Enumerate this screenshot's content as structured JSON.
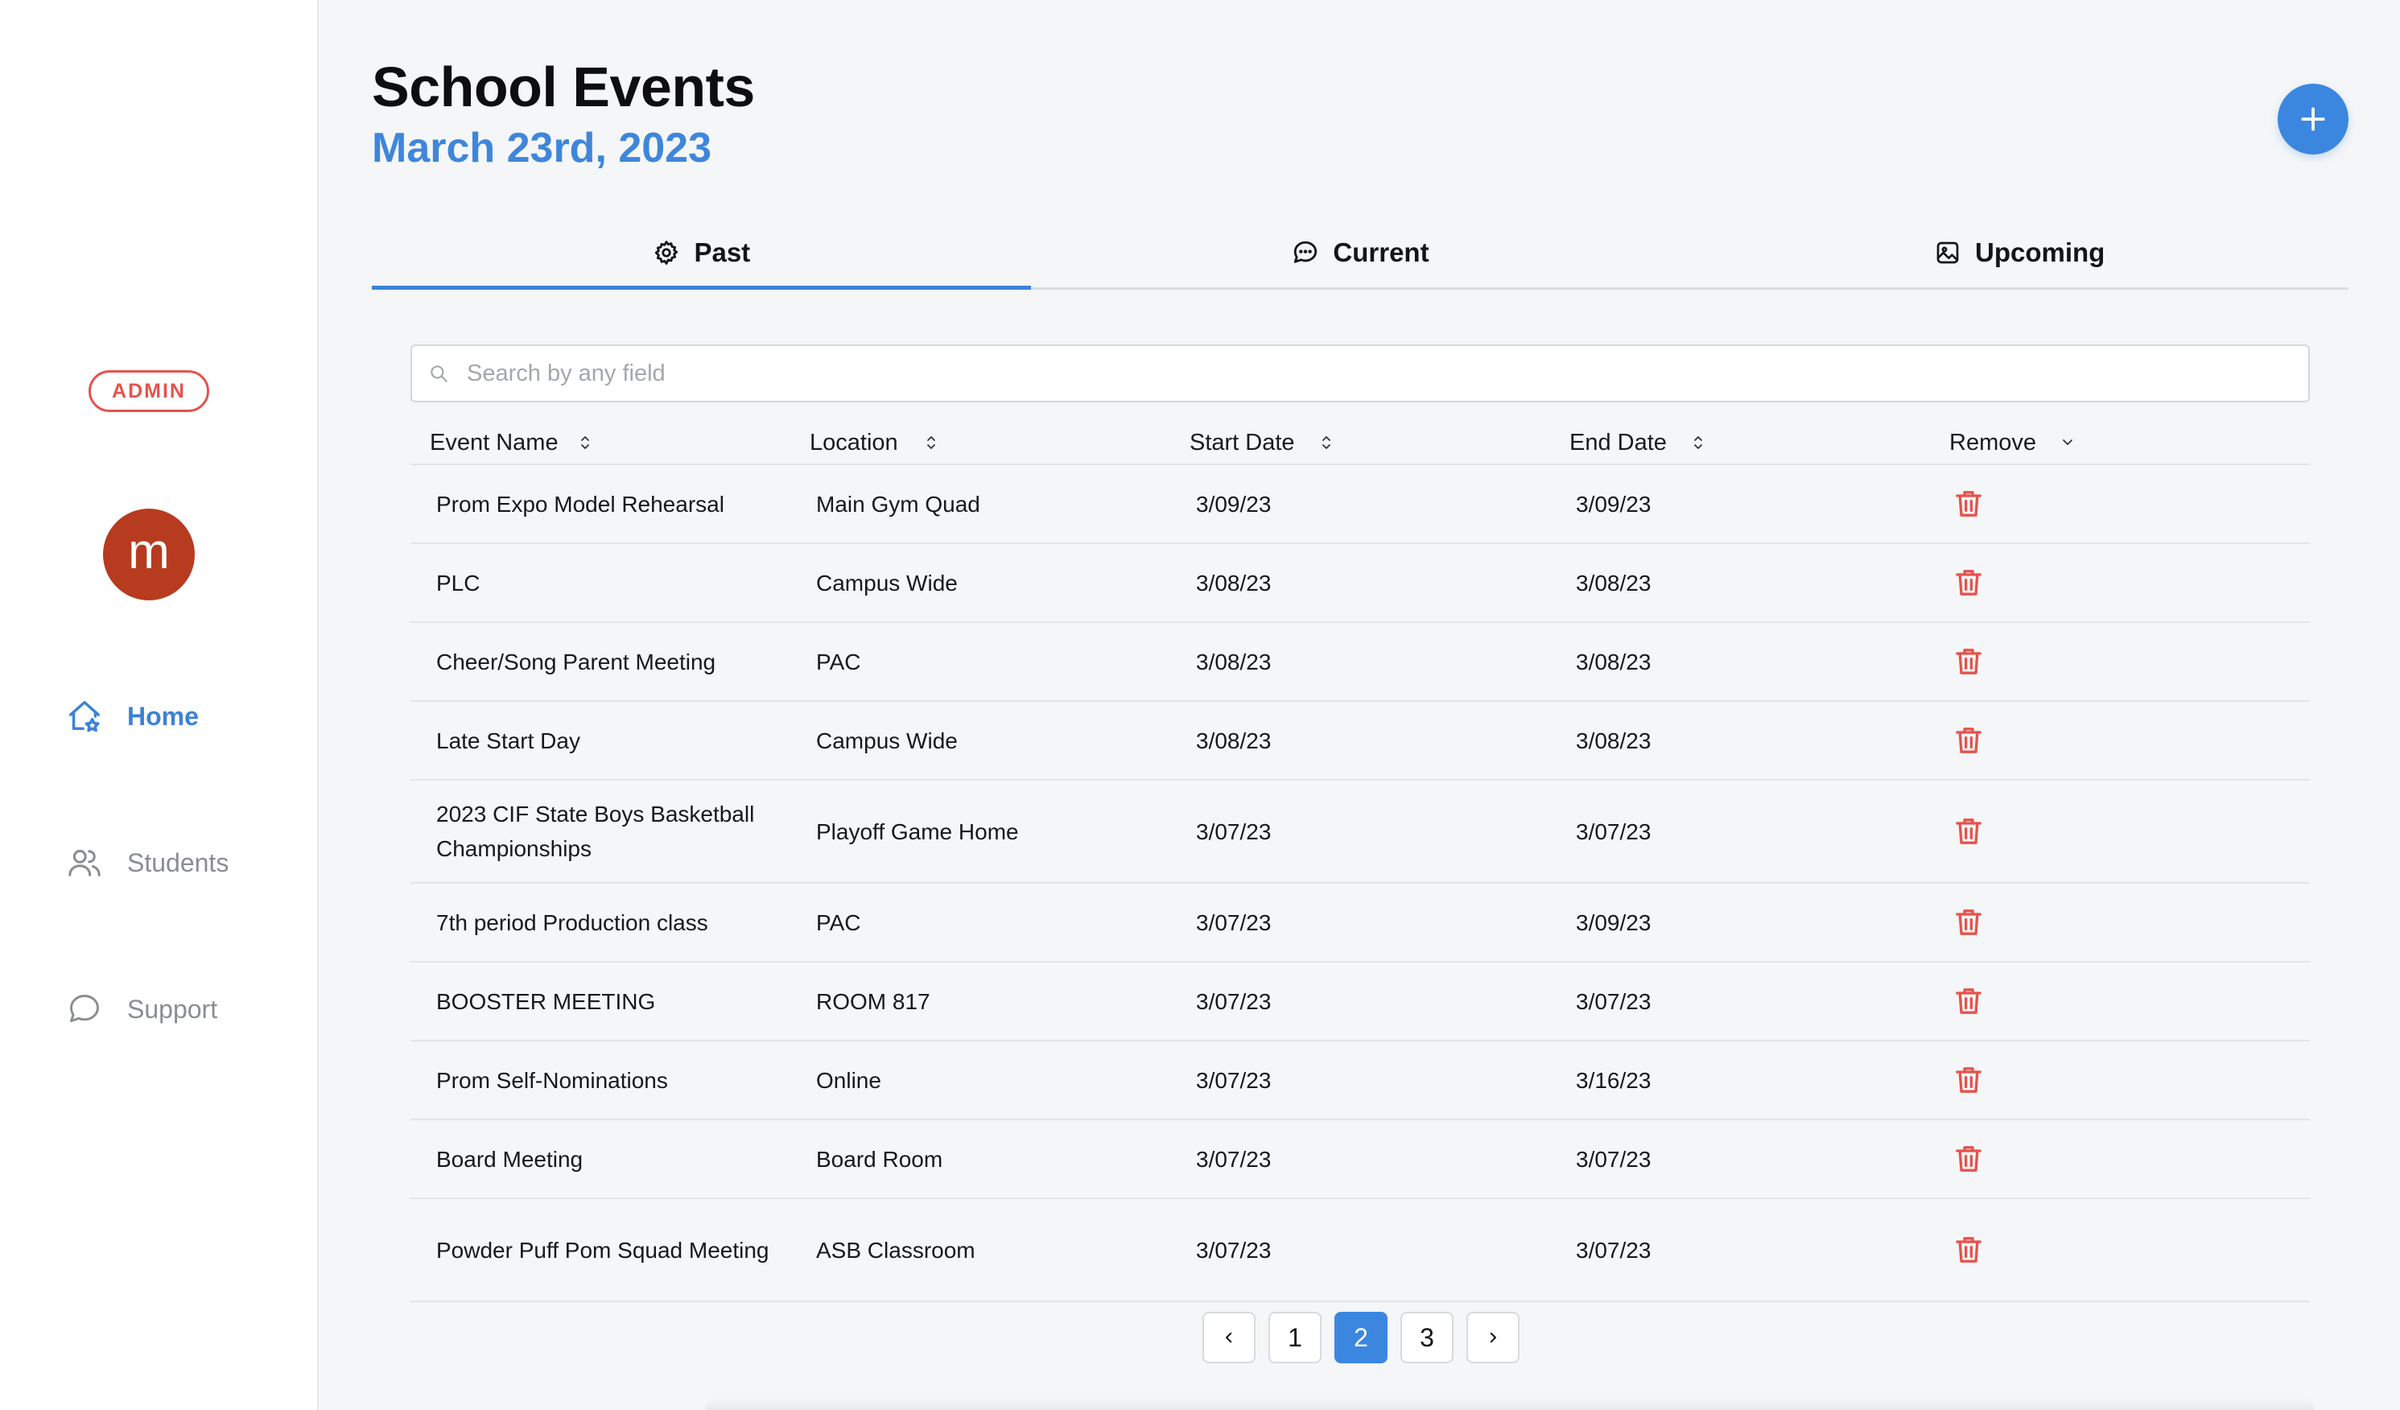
{
  "sidebar": {
    "badge": "ADMIN",
    "avatar_letter": "m",
    "nav": [
      {
        "label": "Home",
        "icon": "home-star-icon",
        "active": true
      },
      {
        "label": "Students",
        "icon": "users-icon",
        "active": false
      },
      {
        "label": "Support",
        "icon": "chat-bubble-icon",
        "active": false
      }
    ]
  },
  "header": {
    "title": "School Events",
    "date": "March 23rd, 2023",
    "add_icon": "plus-icon"
  },
  "tabs": [
    {
      "label": "Past",
      "icon": "gear-icon",
      "active": true
    },
    {
      "label": "Current",
      "icon": "chat-dots-icon",
      "active": false
    },
    {
      "label": "Upcoming",
      "icon": "image-icon",
      "active": false
    }
  ],
  "search": {
    "placeholder": "Search by any field",
    "value": ""
  },
  "table": {
    "headers": [
      "Event Name",
      "Location",
      "Start Date",
      "End Date",
      "Remove"
    ],
    "rows": [
      [
        "Prom Expo Model Rehearsal",
        "Main Gym Quad",
        "3/09/23",
        "3/09/23"
      ],
      [
        "PLC",
        "Campus Wide",
        "3/08/23",
        "3/08/23"
      ],
      [
        "Cheer/Song Parent Meeting",
        "PAC",
        "3/08/23",
        "3/08/23"
      ],
      [
        "Late Start Day",
        "Campus Wide",
        "3/08/23",
        "3/08/23"
      ],
      [
        "2023 CIF State Boys Basketball Championships",
        "Playoff Game Home",
        "3/07/23",
        "3/07/23"
      ],
      [
        "7th period Production class",
        "PAC",
        "3/07/23",
        "3/09/23"
      ],
      [
        "BOOSTER MEETING",
        "ROOM 817",
        "3/07/23",
        "3/07/23"
      ],
      [
        "Prom Self-Nominations",
        "Online",
        "3/07/23",
        "3/16/23"
      ],
      [
        "Board Meeting",
        "Board Room",
        "3/07/23",
        "3/07/23"
      ],
      [
        "Powder Puff Pom Squad Meeting",
        "ASB Classroom",
        "3/07/23",
        "3/07/23"
      ]
    ]
  },
  "pagination": {
    "pages": [
      "1",
      "2",
      "3"
    ],
    "current": "2",
    "prev_icon": "chevron-left-icon",
    "next_icon": "chevron-right-icon"
  },
  "colors": {
    "accent": "#3b82d9",
    "danger": "#e5534b",
    "avatar": "#b73b1e"
  }
}
